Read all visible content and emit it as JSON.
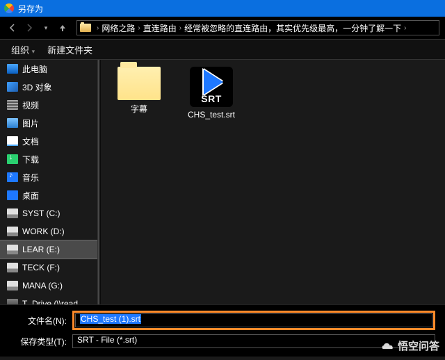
{
  "titlebar": {
    "title": "另存为"
  },
  "breadcrumbs": [
    "网络之路",
    "直连路由",
    "经常被忽略的直连路由，其实优先级最高，一分钟了解一下"
  ],
  "toolbar": {
    "organize": "组织",
    "newfolder": "新建文件夹"
  },
  "sidebar": {
    "items": [
      {
        "label": "此电脑",
        "icon": "i-pc"
      },
      {
        "label": "3D 对象",
        "icon": "i-3d"
      },
      {
        "label": "视频",
        "icon": "i-video"
      },
      {
        "label": "图片",
        "icon": "i-pic"
      },
      {
        "label": "文档",
        "icon": "i-doc"
      },
      {
        "label": "下载",
        "icon": "i-dl"
      },
      {
        "label": "音乐",
        "icon": "i-music"
      },
      {
        "label": "桌面",
        "icon": "i-desk"
      },
      {
        "label": "SYST (C:)",
        "icon": "i-drive"
      },
      {
        "label": "WORK (D:)",
        "icon": "i-drive"
      },
      {
        "label": "LEAR (E:)",
        "icon": "i-drive",
        "selected": true
      },
      {
        "label": "TECK (F:)",
        "icon": "i-drive"
      },
      {
        "label": "MANA (G:)",
        "icon": "i-drive"
      },
      {
        "label": "T_Drive (\\\\read",
        "icon": "i-read"
      }
    ]
  },
  "content": {
    "items": [
      {
        "type": "folder",
        "label": "字幕"
      },
      {
        "type": "srt",
        "label": "CHS_test.srt",
        "badge": "SRT"
      }
    ]
  },
  "bottom": {
    "filename_label": "文件名(N):",
    "filename_value": "CHS_test (1).srt",
    "filetype_label": "保存类型(T):",
    "filetype_value": "SRT - File (*.srt)"
  },
  "watermark": "悟空问答"
}
